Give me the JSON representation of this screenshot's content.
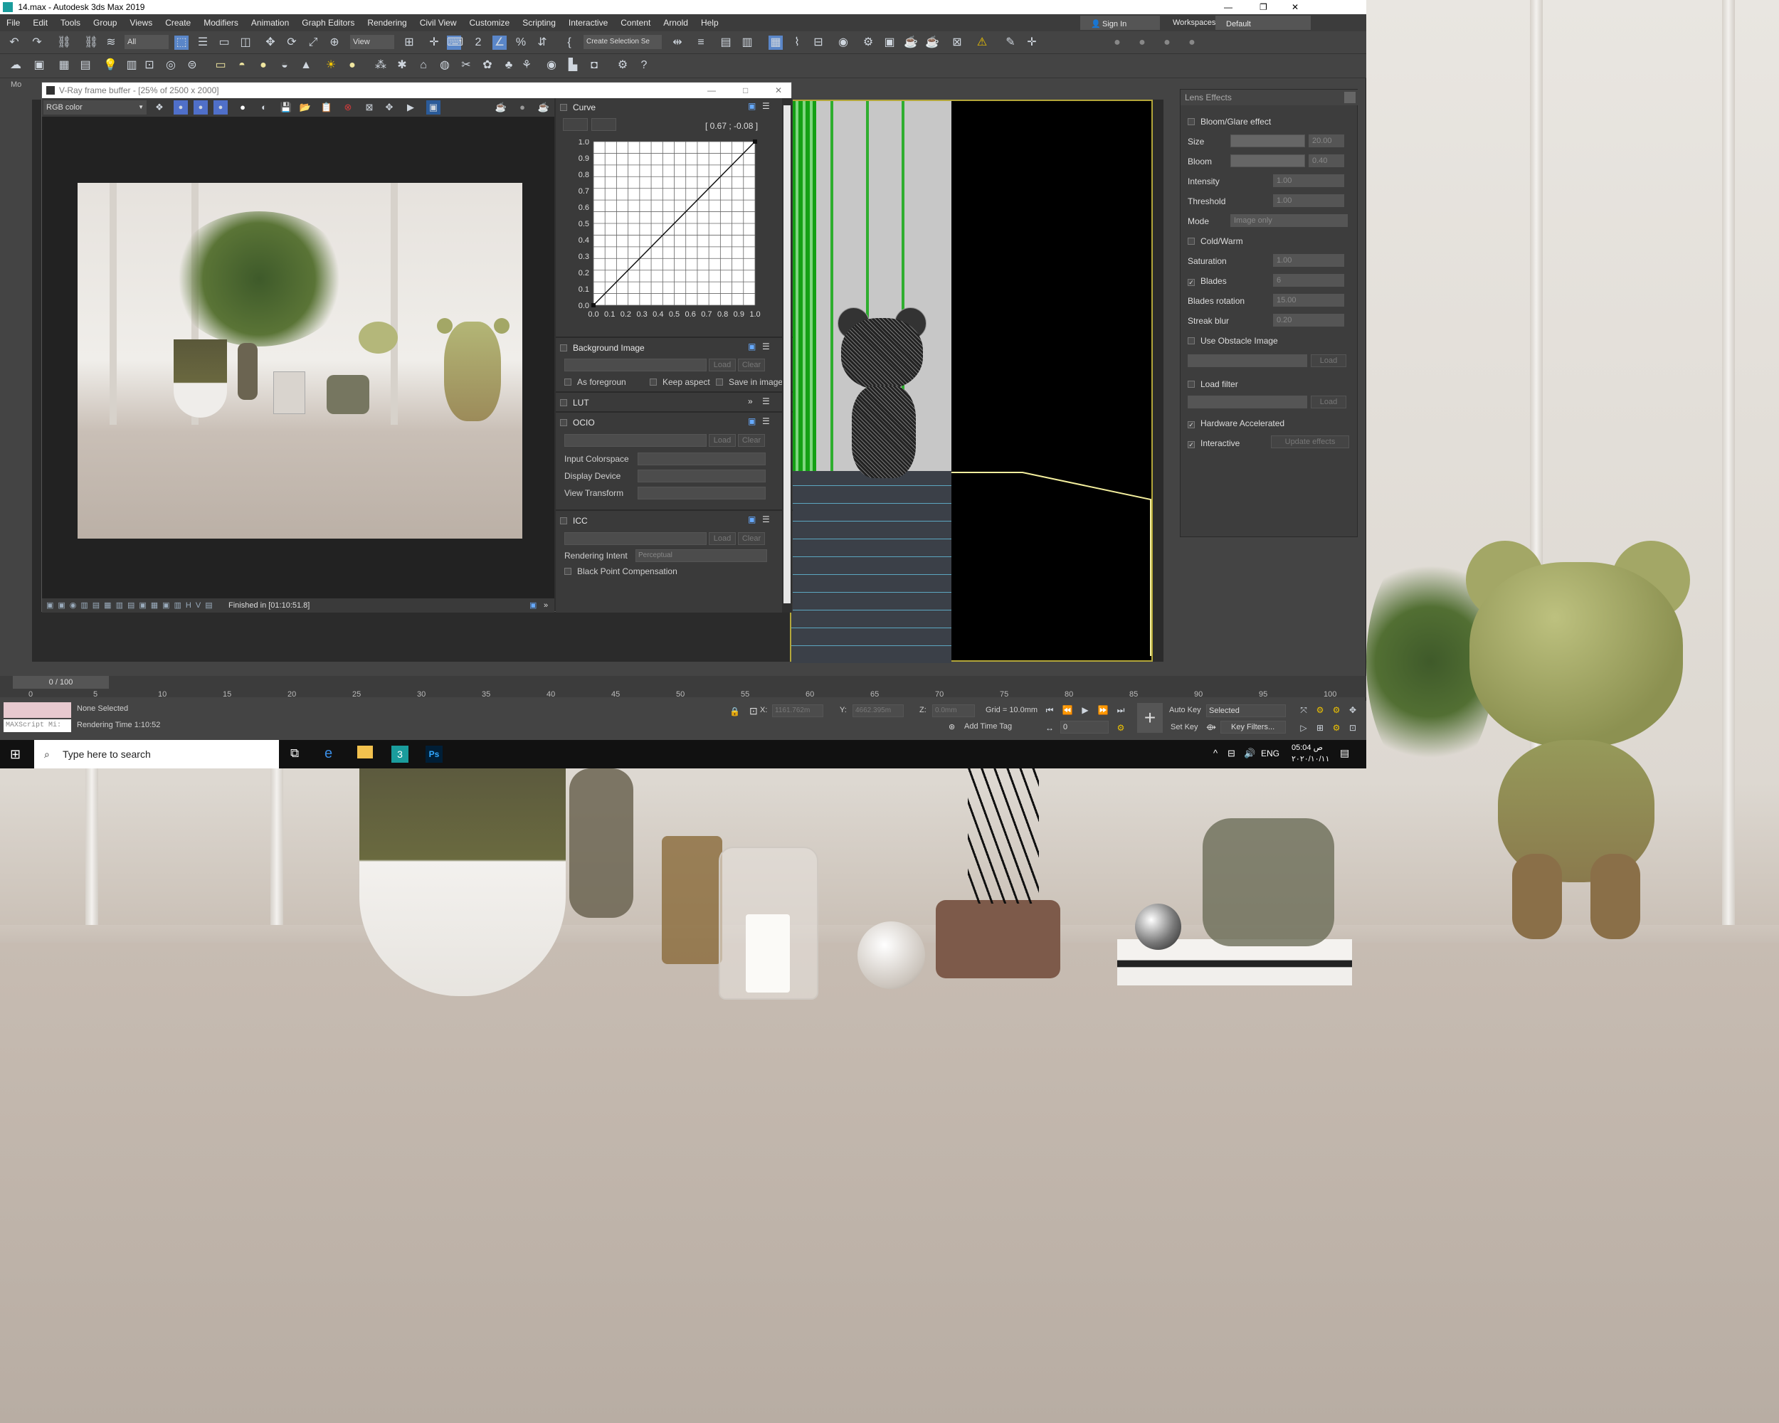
{
  "window": {
    "title": "14.max - Autodesk 3ds Max 2019"
  },
  "menu": [
    "File",
    "Edit",
    "Tools",
    "Group",
    "Views",
    "Create",
    "Modifiers",
    "Animation",
    "Graph Editors",
    "Rendering",
    "Civil View",
    "Customize",
    "Scripting",
    "Interactive",
    "Content",
    "Arnold",
    "Help"
  ],
  "account": {
    "sign_in": "Sign In",
    "workspaces_label": "Workspaces:",
    "workspace_value": "Default"
  },
  "toolbar": {
    "selection_filter": "All",
    "ref_coord": "View",
    "selection_set": "Create Selection Se"
  },
  "viewport_label": "Mo",
  "vfb": {
    "title": "V-Ray frame buffer - [25% of 2500 x 2000]",
    "channel": "RGB color",
    "status": "Finished in [01:10:51.8]",
    "curve": {
      "title": "Curve",
      "readout": "[ 0.67 ; -0.08 ]",
      "y_ticks": [
        "1.0",
        "0.9",
        "0.8",
        "0.7",
        "0.6",
        "0.5",
        "0.4",
        "0.3",
        "0.2",
        "0.1",
        "0.0"
      ],
      "x_ticks": [
        "0.0",
        "0.1",
        "0.2",
        "0.3",
        "0.4",
        "0.5",
        "0.6",
        "0.7",
        "0.8",
        "0.9",
        "1.0"
      ]
    },
    "background_image": {
      "title": "Background Image",
      "load": "Load",
      "clear": "Clear",
      "as_foreground": "As foregroun",
      "keep_aspect": "Keep aspect",
      "save_in_image": "Save in image"
    },
    "lut": {
      "title": "LUT"
    },
    "ocio": {
      "title": "OCIO",
      "load": "Load",
      "clear": "Clear",
      "input_colorspace": "Input Colorspace",
      "display_device": "Display Device",
      "view_transform": "View Transform"
    },
    "icc": {
      "title": "ICC",
      "load": "Load",
      "clear": "Clear",
      "rendering_intent": "Rendering Intent",
      "rendering_intent_value": "Perceptual",
      "black_point": "Black Point Compensation"
    }
  },
  "lens": {
    "title": "Lens Effects",
    "bloom_glare": "Bloom/Glare effect",
    "size_label": "Size",
    "size_value": "20.00",
    "bloom_label": "Bloom",
    "bloom_value": "0.40",
    "intensity_label": "Intensity",
    "intensity_value": "1.00",
    "threshold_label": "Threshold",
    "threshold_value": "1.00",
    "mode_label": "Mode",
    "mode_value": "Image only",
    "cold_warm": "Cold/Warm",
    "saturation_label": "Saturation",
    "saturation_value": "1.00",
    "blades_label": "Blades",
    "blades_value": "6",
    "blades_rotation_label": "Blades rotation",
    "blades_rotation_value": "15.00",
    "streak_blur_label": "Streak blur",
    "streak_blur_value": "0.20",
    "use_obstacle": "Use Obstacle Image",
    "load": "Load",
    "load_filter": "Load filter",
    "hardware": "Hardware Accelerated",
    "interactive": "Interactive",
    "update": "Update effects"
  },
  "timeline": {
    "frame": "0 / 100",
    "ticks": [
      "0",
      "5",
      "10",
      "15",
      "20",
      "25",
      "30",
      "35",
      "40",
      "45",
      "50",
      "55",
      "60",
      "65",
      "70",
      "75",
      "80",
      "85",
      "90",
      "95",
      "100"
    ]
  },
  "status": {
    "maxscript": "MAXScript Mi:",
    "none_selected": "None Selected",
    "rendering_time": "Rendering Time  1:10:52",
    "x_label": "X:",
    "x_value": "1161.762m",
    "y_label": "Y:",
    "y_value": "4662.395m",
    "z_label": "Z:",
    "z_value": "0.0mm",
    "grid": "Grid = 10.0mm",
    "add_time_tag": "Add Time Tag",
    "auto_key": "Auto Key",
    "set_key": "Set Key",
    "selected": "Selected",
    "key_filters": "Key Filters...",
    "frame_field": "0"
  },
  "taskbar": {
    "search_placeholder": "Type here to search",
    "lang": "ENG",
    "time": "05:04 ص",
    "date": "٢٠٢٠/١٠/١١"
  }
}
